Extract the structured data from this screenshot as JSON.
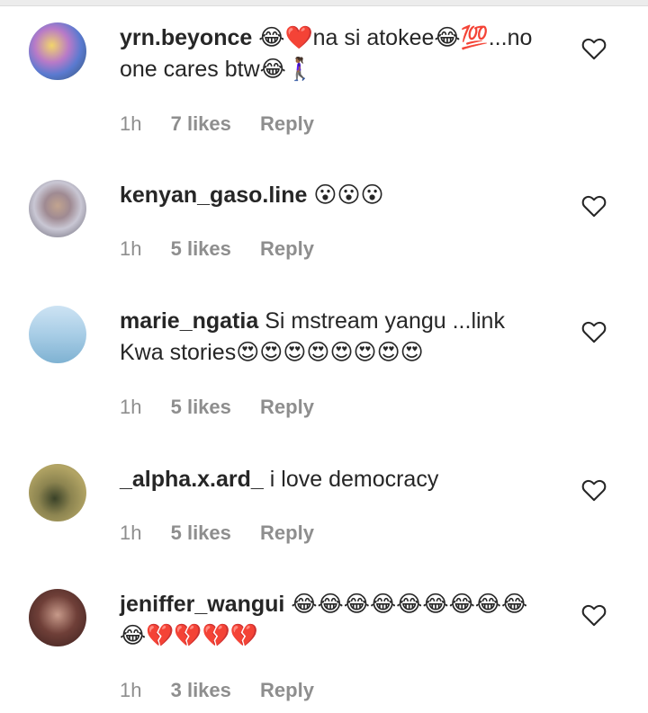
{
  "comments": [
    {
      "username": "yrn.beyonce",
      "text": "😂❤️na si atokee😂💯...no one cares btw😂🚶🏾‍♀️",
      "time": "1h",
      "likes": "7 likes",
      "reply": "Reply"
    },
    {
      "username": "kenyan_gaso.line",
      "text": "😮😮😮",
      "time": "1h",
      "likes": "5 likes",
      "reply": "Reply"
    },
    {
      "username": "marie_ngatia",
      "text": "Si mstream yangu ...link Kwa stories😍😍😍😍😍😍😍😍",
      "time": "1h",
      "likes": "5 likes",
      "reply": "Reply"
    },
    {
      "username": "_alpha.x.ard_",
      "text": "i love democracy",
      "time": "1h",
      "likes": "5 likes",
      "reply": "Reply"
    },
    {
      "username": "jeniffer_wangui",
      "text": "😂😂😂😂😂😂😂😂😂😂💔💔💔💔",
      "time": "1h",
      "likes": "3 likes",
      "reply": "Reply"
    }
  ],
  "icons": {
    "like": "heart-outline-icon"
  },
  "colors": {
    "text": "#262626",
    "meta": "#8e8e8e"
  }
}
